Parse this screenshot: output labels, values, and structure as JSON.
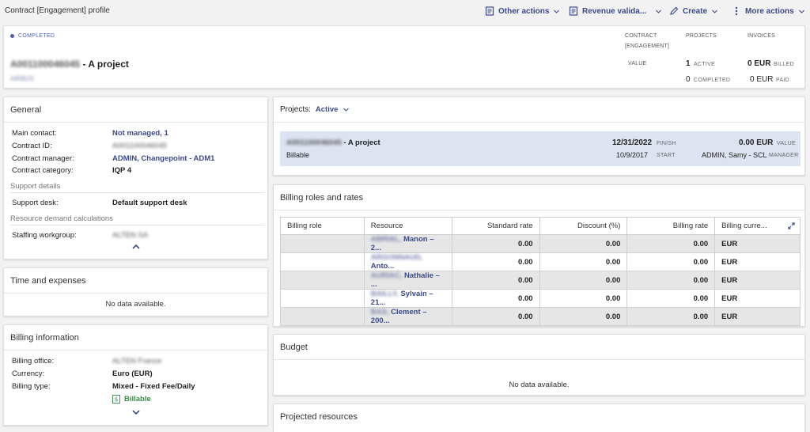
{
  "header": {
    "title": "Contract [Engagement] profile",
    "other_actions": "Other actions",
    "revenue": "Revenue valida...",
    "create": "Create",
    "more_actions": "More actions"
  },
  "summary": {
    "status": "COMPLETED",
    "project_id": "A001100046045",
    "project_name": "- A project",
    "customer": "AIRBUS",
    "col_contract": "CONTRACT",
    "col_contract_2": "[ENGAGEMENT]",
    "col_projects": "PROJECTS",
    "col_invoices": "INVOICES",
    "value_label": "VALUE",
    "active_count": "1",
    "active_label": "ACTIVE",
    "completed_count": "0",
    "completed_label": "COMPLETED",
    "billed_amount": "0 EUR",
    "billed_label": "BILLED",
    "paid_amount": "0 EUR",
    "paid_label": "PAID"
  },
  "general": {
    "title": "General",
    "main_contact_label": "Main contact:",
    "main_contact_value": "Not managed, 1",
    "contract_id_label": "Contract ID:",
    "contract_id_value": "A001100046045",
    "manager_label": "Contract manager:",
    "manager_value": "ADMIN, Changepoint - ADM1",
    "category_label": "Contract category:",
    "category_value": "IQP 4",
    "support_section": "Support details",
    "support_desk_label": "Support desk:",
    "support_desk_value": "Default support desk",
    "resource_section": "Resource demand calculations",
    "staffing_label": "Staffing workgroup:",
    "staffing_value": "ALTEN SA"
  },
  "time": {
    "title": "Time and expenses",
    "empty": "No data available."
  },
  "billing": {
    "title": "Billing information",
    "office_label": "Billing office:",
    "office_value": "ALTEN France",
    "currency_label": "Currency:",
    "currency_value": "Euro (EUR)",
    "type_label": "Billing type:",
    "type_value": "Mixed - Fixed Fee/Daily",
    "billable": "Billable"
  },
  "projects": {
    "label": "Projects:",
    "filter": "Active",
    "item": {
      "id": "A001100046045",
      "name": "- A project",
      "type": "Billable",
      "finish_date": "12/31/2022",
      "finish_label": "FINISH",
      "start_date": "10/9/2017",
      "start_label": "START",
      "value": "0.00 EUR",
      "value_label": "VALUE",
      "manager": "ADMIN, Samy - SCL",
      "manager_label": "MANAGER"
    }
  },
  "rates": {
    "title": "Billing roles and rates",
    "columns": [
      "Billing role",
      "Resource",
      "Standard rate",
      "Discount (%)",
      "Billing rate",
      "Billing curre..."
    ],
    "rows": [
      {
        "role": "",
        "resource_last": "ABRIAL,",
        "resource_first": "Manon – 2...",
        "standard": "0.00",
        "discount": "0.00",
        "billing": "0.00",
        "currency": "EUR"
      },
      {
        "role": "",
        "resource_last": "ARGONNAUD,",
        "resource_first": "Anto...",
        "standard": "0.00",
        "discount": "0.00",
        "billing": "0.00",
        "currency": "EUR"
      },
      {
        "role": "",
        "resource_last": "AURIAC,",
        "resource_first": "Nathalie – ...",
        "standard": "0.00",
        "discount": "0.00",
        "billing": "0.00",
        "currency": "EUR"
      },
      {
        "role": "",
        "resource_last": "BAILLY,",
        "resource_first": "Sylvain – 21...",
        "standard": "0.00",
        "discount": "0.00",
        "billing": "0.00",
        "currency": "EUR"
      },
      {
        "role": "",
        "resource_last": "BAS,",
        "resource_first": "Clement – 200...",
        "standard": "0.00",
        "discount": "0.00",
        "billing": "0.00",
        "currency": "EUR"
      }
    ]
  },
  "budget": {
    "title": "Budget",
    "empty": "No data available."
  },
  "projected": {
    "title": "Projected resources"
  }
}
